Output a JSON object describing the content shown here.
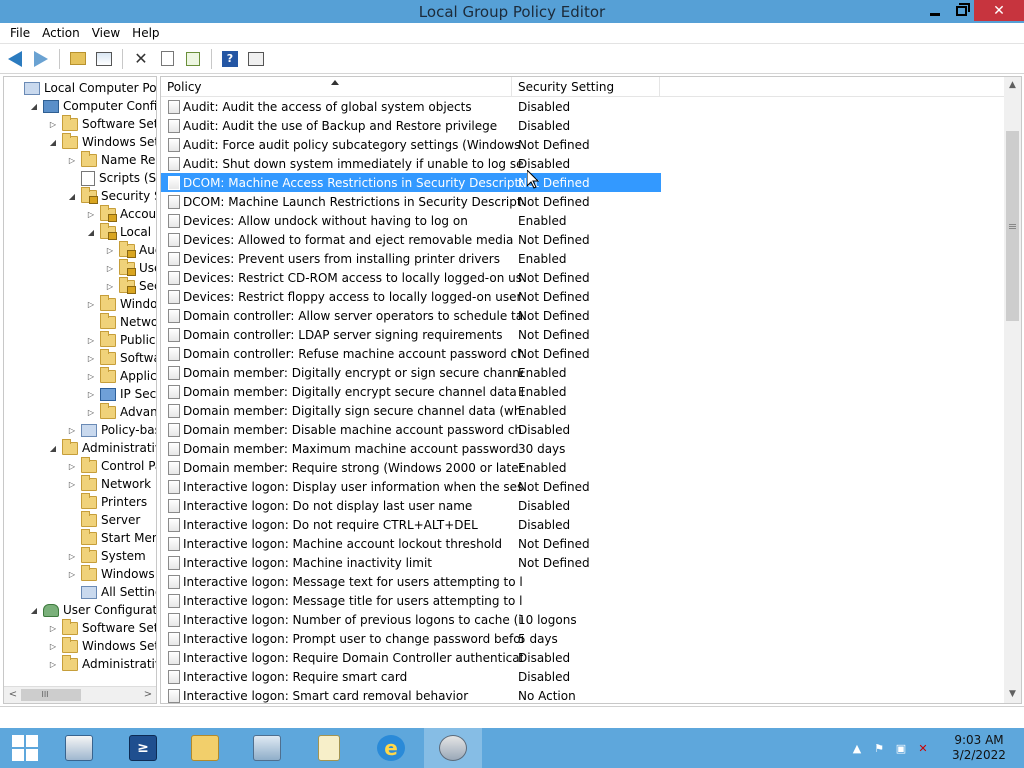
{
  "window": {
    "title": "Local Group Policy Editor",
    "minimize": "",
    "close": "✕"
  },
  "menu": [
    "File",
    "Action",
    "View",
    "Help"
  ],
  "tree": [
    {
      "label": "Local Computer Policy",
      "indent": 0,
      "twisty": "",
      "icon": "policy"
    },
    {
      "label": "Computer Configura",
      "indent": 1,
      "twisty": "◢",
      "icon": "computer"
    },
    {
      "label": "Software Settings",
      "indent": 2,
      "twisty": "▷",
      "icon": "folder"
    },
    {
      "label": "Windows Setting",
      "indent": 2,
      "twisty": "◢",
      "icon": "folder"
    },
    {
      "label": "Name Resolu",
      "indent": 3,
      "twisty": "▷",
      "icon": "folder"
    },
    {
      "label": "Scripts (Startu",
      "indent": 3,
      "twisty": "",
      "icon": "doc"
    },
    {
      "label": "Security Settir",
      "indent": 3,
      "twisty": "◢",
      "icon": "lockfolder"
    },
    {
      "label": "Account P",
      "indent": 4,
      "twisty": "▷",
      "icon": "lockfolder"
    },
    {
      "label": "Local Poli",
      "indent": 4,
      "twisty": "◢",
      "icon": "lockfolder"
    },
    {
      "label": "Audit",
      "indent": 5,
      "twisty": "▷",
      "icon": "lockfolder"
    },
    {
      "label": "User R",
      "indent": 5,
      "twisty": "▷",
      "icon": "lockfolder"
    },
    {
      "label": "Securi",
      "indent": 5,
      "twisty": "▷",
      "icon": "lockfolder"
    },
    {
      "label": "Windows",
      "indent": 4,
      "twisty": "▷",
      "icon": "folder"
    },
    {
      "label": "Network L",
      "indent": 4,
      "twisty": "",
      "icon": "folder"
    },
    {
      "label": "Public Key",
      "indent": 4,
      "twisty": "▷",
      "icon": "folder"
    },
    {
      "label": "Software F",
      "indent": 4,
      "twisty": "▷",
      "icon": "folder"
    },
    {
      "label": "Applicatic",
      "indent": 4,
      "twisty": "▷",
      "icon": "folder"
    },
    {
      "label": "IP Security",
      "indent": 4,
      "twisty": "▷",
      "icon": "ipsec"
    },
    {
      "label": "Advanced",
      "indent": 4,
      "twisty": "▷",
      "icon": "folder"
    },
    {
      "label": "Policy-based",
      "indent": 3,
      "twisty": "▷",
      "icon": "policy"
    },
    {
      "label": "Administrative Te",
      "indent": 2,
      "twisty": "◢",
      "icon": "folder"
    },
    {
      "label": "Control Panel",
      "indent": 3,
      "twisty": "▷",
      "icon": "folder"
    },
    {
      "label": "Network",
      "indent": 3,
      "twisty": "▷",
      "icon": "folder"
    },
    {
      "label": "Printers",
      "indent": 3,
      "twisty": "",
      "icon": "folder"
    },
    {
      "label": "Server",
      "indent": 3,
      "twisty": "",
      "icon": "folder"
    },
    {
      "label": "Start Menu ar",
      "indent": 3,
      "twisty": "",
      "icon": "folder"
    },
    {
      "label": "System",
      "indent": 3,
      "twisty": "▷",
      "icon": "folder"
    },
    {
      "label": "Windows Cor",
      "indent": 3,
      "twisty": "▷",
      "icon": "folder"
    },
    {
      "label": "All Settings",
      "indent": 3,
      "twisty": "",
      "icon": "policy"
    },
    {
      "label": "User Configuration",
      "indent": 1,
      "twisty": "◢",
      "icon": "user"
    },
    {
      "label": "Software Settings",
      "indent": 2,
      "twisty": "▷",
      "icon": "folder"
    },
    {
      "label": "Windows Setting",
      "indent": 2,
      "twisty": "▷",
      "icon": "folder"
    },
    {
      "label": "Administrative Te",
      "indent": 2,
      "twisty": "▷",
      "icon": "folder"
    }
  ],
  "columns": {
    "policy": "Policy",
    "setting": "Security Setting"
  },
  "rows": [
    {
      "policy": "Audit: Audit the access of global system objects",
      "setting": "Disabled"
    },
    {
      "policy": "Audit: Audit the use of Backup and Restore privilege",
      "setting": "Disabled"
    },
    {
      "policy": "Audit: Force audit policy subcategory settings (Windows Vis...",
      "setting": "Not Defined"
    },
    {
      "policy": "Audit: Shut down system immediately if unable to log secur...",
      "setting": "Disabled"
    },
    {
      "policy": "DCOM: Machine Access Restrictions in Security Descriptor D...",
      "setting": "Not Defined",
      "selected": true
    },
    {
      "policy": "DCOM: Machine Launch Restrictions in Security Descriptor ...",
      "setting": "Not Defined"
    },
    {
      "policy": "Devices: Allow undock without having to log on",
      "setting": "Enabled"
    },
    {
      "policy": "Devices: Allowed to format and eject removable media",
      "setting": "Not Defined"
    },
    {
      "policy": "Devices: Prevent users from installing printer drivers",
      "setting": "Enabled"
    },
    {
      "policy": "Devices: Restrict CD-ROM access to locally logged-on user ...",
      "setting": "Not Defined"
    },
    {
      "policy": "Devices: Restrict floppy access to locally logged-on user only",
      "setting": "Not Defined"
    },
    {
      "policy": "Domain controller: Allow server operators to schedule tasks",
      "setting": "Not Defined"
    },
    {
      "policy": "Domain controller: LDAP server signing requirements",
      "setting": "Not Defined"
    },
    {
      "policy": "Domain controller: Refuse machine account password chan...",
      "setting": "Not Defined"
    },
    {
      "policy": "Domain member: Digitally encrypt or sign secure channel d...",
      "setting": "Enabled"
    },
    {
      "policy": "Domain member: Digitally encrypt secure channel data (wh...",
      "setting": "Enabled"
    },
    {
      "policy": "Domain member: Digitally sign secure channel data (when ...",
      "setting": "Enabled"
    },
    {
      "policy": "Domain member: Disable machine account password chan...",
      "setting": "Disabled"
    },
    {
      "policy": "Domain member: Maximum machine account password age",
      "setting": "30 days"
    },
    {
      "policy": "Domain member: Require strong (Windows 2000 or later) se...",
      "setting": "Enabled"
    },
    {
      "policy": "Interactive logon: Display user information when the session...",
      "setting": "Not Defined"
    },
    {
      "policy": "Interactive logon: Do not display last user name",
      "setting": "Disabled"
    },
    {
      "policy": "Interactive logon: Do not require CTRL+ALT+DEL",
      "setting": "Disabled"
    },
    {
      "policy": "Interactive logon: Machine account lockout threshold",
      "setting": "Not Defined"
    },
    {
      "policy": "Interactive logon: Machine inactivity limit",
      "setting": "Not Defined"
    },
    {
      "policy": "Interactive logon: Message text for users attempting to log on",
      "setting": ""
    },
    {
      "policy": "Interactive logon: Message title for users attempting to log on",
      "setting": ""
    },
    {
      "policy": "Interactive logon: Number of previous logons to cache (in c...",
      "setting": "10 logons"
    },
    {
      "policy": "Interactive logon: Prompt user to change password before e...",
      "setting": "5 days"
    },
    {
      "policy": "Interactive logon: Require Domain Controller authentication...",
      "setting": "Disabled"
    },
    {
      "policy": "Interactive logon: Require smart card",
      "setting": "Disabled"
    },
    {
      "policy": "Interactive logon: Smart card removal behavior",
      "setting": "No Action"
    }
  ],
  "scroll": {
    "left_left": "<",
    "left_grip": "III",
    "left_right": ">",
    "up": "▲",
    "down": "▼",
    "grip": "≡"
  },
  "taskbar": {
    "clock_time": "9:03 AM",
    "clock_date": "3/2/2022",
    "ps_label": "≥",
    "ie_label": "e",
    "tray_chevron": "▲",
    "tray_flag": "⚑",
    "tray_net": "▣",
    "tray_sound": "✕"
  },
  "colors": {
    "titlebar": "#56a0d6",
    "selection": "#3399ff",
    "taskbar": "#5ea7dc",
    "close": "#c7343e"
  }
}
